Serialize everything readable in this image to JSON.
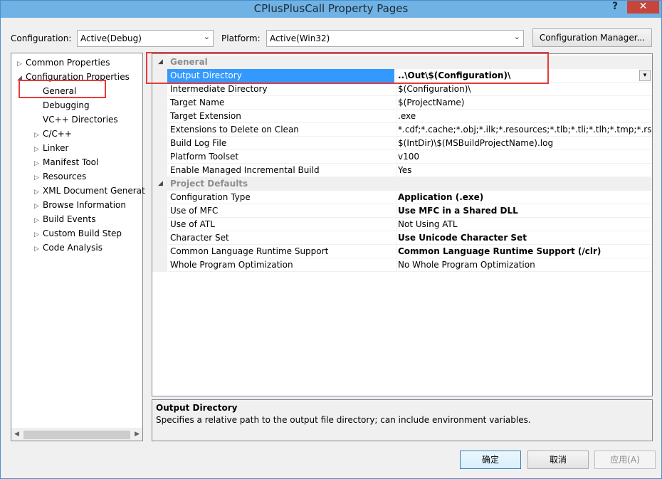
{
  "window": {
    "title": "CPlusPlusCall Property Pages",
    "help": "?",
    "close": "✕"
  },
  "config": {
    "label": "Configuration:",
    "value": "Active(Debug)",
    "platform_label": "Platform:",
    "platform_value": "Active(Win32)",
    "manager_button": "Configuration Manager..."
  },
  "tree": {
    "items": [
      {
        "label": "Common Properties",
        "twisty": "▷"
      },
      {
        "label": "Configuration Properties",
        "twisty": "◢"
      },
      {
        "label": "General",
        "twisty": ""
      },
      {
        "label": "Debugging",
        "twisty": ""
      },
      {
        "label": "VC++ Directories",
        "twisty": ""
      },
      {
        "label": "C/C++",
        "twisty": "▷"
      },
      {
        "label": "Linker",
        "twisty": "▷"
      },
      {
        "label": "Manifest Tool",
        "twisty": "▷"
      },
      {
        "label": "Resources",
        "twisty": "▷"
      },
      {
        "label": "XML Document Generat",
        "twisty": "▷"
      },
      {
        "label": "Browse Information",
        "twisty": "▷"
      },
      {
        "label": "Build Events",
        "twisty": "▷"
      },
      {
        "label": "Custom Build Step",
        "twisty": "▷"
      },
      {
        "label": "Code Analysis",
        "twisty": "▷"
      }
    ]
  },
  "grid": {
    "cat_general": "General",
    "cat_defaults": "Project Defaults",
    "rows": [
      {
        "name": "Output Directory",
        "value": "..\\Out\\$(Configuration)\\"
      },
      {
        "name": "Intermediate Directory",
        "value": "$(Configuration)\\"
      },
      {
        "name": "Target Name",
        "value": "$(ProjectName)"
      },
      {
        "name": "Target Extension",
        "value": ".exe"
      },
      {
        "name": "Extensions to Delete on Clean",
        "value": "*.cdf;*.cache;*.obj;*.ilk;*.resources;*.tlb;*.tli;*.tlh;*.tmp;*.rsp;*.pgc"
      },
      {
        "name": "Build Log File",
        "value": "$(IntDir)\\$(MSBuildProjectName).log"
      },
      {
        "name": "Platform Toolset",
        "value": "v100"
      },
      {
        "name": "Enable Managed Incremental Build",
        "value": "Yes"
      },
      {
        "name": "Configuration Type",
        "value": "Application (.exe)"
      },
      {
        "name": "Use of MFC",
        "value": "Use MFC in a Shared DLL"
      },
      {
        "name": "Use of ATL",
        "value": "Not Using ATL"
      },
      {
        "name": "Character Set",
        "value": "Use Unicode Character Set"
      },
      {
        "name": "Common Language Runtime Support",
        "value": "Common Language Runtime Support (/clr)"
      },
      {
        "name": "Whole Program Optimization",
        "value": "No Whole Program Optimization"
      }
    ]
  },
  "description": {
    "title": "Output Directory",
    "text": "Specifies a relative path to the output file directory; can include environment variables."
  },
  "buttons": {
    "ok": "确定",
    "cancel": "取消",
    "apply": "应用(A)"
  },
  "colors": {
    "selection": "#3399ff",
    "highlight_box": "#e83a3a",
    "titlebar": "#6fb2e3"
  }
}
